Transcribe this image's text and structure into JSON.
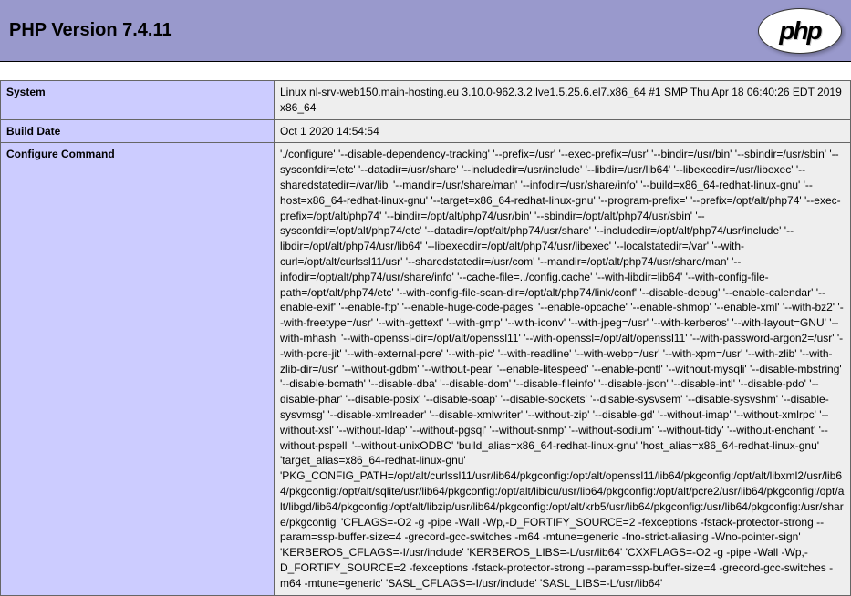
{
  "header": {
    "title": "PHP Version 7.4.11",
    "logo_text": "php"
  },
  "rows": [
    {
      "label": "System",
      "value": "Linux nl-srv-web150.main-hosting.eu 3.10.0-962.3.2.lve1.5.25.6.el7.x86_64 #1 SMP Thu Apr 18 06:40:26 EDT 2019 x86_64"
    },
    {
      "label": "Build Date",
      "value": "Oct 1 2020 14:54:54"
    },
    {
      "label": "Configure Command",
      "value": "'./configure' '--disable-dependency-tracking' '--prefix=/usr' '--exec-prefix=/usr' '--bindir=/usr/bin' '--sbindir=/usr/sbin' '--sysconfdir=/etc' '--datadir=/usr/share' '--includedir=/usr/include' '--libdir=/usr/lib64' '--libexecdir=/usr/libexec' '--sharedstatedir=/var/lib' '--mandir=/usr/share/man' '--infodir=/usr/share/info' '--build=x86_64-redhat-linux-gnu' '--host=x86_64-redhat-linux-gnu' '--target=x86_64-redhat-linux-gnu' '--program-prefix=' '--prefix=/opt/alt/php74' '--exec-prefix=/opt/alt/php74' '--bindir=/opt/alt/php74/usr/bin' '--sbindir=/opt/alt/php74/usr/sbin' '--sysconfdir=/opt/alt/php74/etc' '--datadir=/opt/alt/php74/usr/share' '--includedir=/opt/alt/php74/usr/include' '--libdir=/opt/alt/php74/usr/lib64' '--libexecdir=/opt/alt/php74/usr/libexec' '--localstatedir=/var' '--with-curl=/opt/alt/curlssl11/usr' '--sharedstatedir=/usr/com' '--mandir=/opt/alt/php74/usr/share/man' '--infodir=/opt/alt/php74/usr/share/info' '--cache-file=../config.cache' '--with-libdir=lib64' '--with-config-file-path=/opt/alt/php74/etc' '--with-config-file-scan-dir=/opt/alt/php74/link/conf' '--disable-debug' '--enable-calendar' '--enable-exif' '--enable-ftp' '--enable-huge-code-pages' '--enable-opcache' '--enable-shmop' '--enable-xml' '--with-bz2' '--with-freetype=/usr' '--with-gettext' '--with-gmp' '--with-iconv' '--with-jpeg=/usr' '--with-kerberos' '--with-layout=GNU' '--with-mhash' '--with-openssl-dir=/opt/alt/openssl11' '--with-openssl=/opt/alt/openssl11' '--with-password-argon2=/usr' '--with-pcre-jit' '--with-external-pcre' '--with-pic' '--with-readline' '--with-webp=/usr' '--with-xpm=/usr' '--with-zlib' '--with-zlib-dir=/usr' '--without-gdbm' '--without-pear' '--enable-litespeed' '--enable-pcntl' '--without-mysqli' '--disable-mbstring' '--disable-bcmath' '--disable-dba' '--disable-dom' '--disable-fileinfo' '--disable-json' '--disable-intl' '--disable-pdo' '--disable-phar' '--disable-posix' '--disable-soap' '--disable-sockets' '--disable-sysvsem' '--disable-sysvshm' '--disable-sysvmsg' '--disable-xmlreader' '--disable-xmlwriter' '--without-zip' '--disable-gd' '--without-imap' '--without-xmlrpc' '--without-xsl' '--without-ldap' '--without-pgsql' '--without-snmp' '--without-sodium' '--without-tidy' '--without-enchant' '--without-pspell' '--without-unixODBC' 'build_alias=x86_64-redhat-linux-gnu' 'host_alias=x86_64-redhat-linux-gnu' 'target_alias=x86_64-redhat-linux-gnu' 'PKG_CONFIG_PATH=/opt/alt/curlssl11/usr/lib64/pkgconfig:/opt/alt/openssl11/lib64/pkgconfig:/opt/alt/libxml2/usr/lib64/pkgconfig:/opt/alt/sqlite/usr/lib64/pkgconfig:/opt/alt/libicu/usr/lib64/pkgconfig:/opt/alt/pcre2/usr/lib64/pkgconfig:/opt/alt/libgd/lib64/pkgconfig:/opt/alt/libzip/usr/lib64/pkgconfig:/opt/alt/krb5/usr/lib64/pkgconfig:/usr/lib64/pkgconfig:/usr/share/pkgconfig' 'CFLAGS=-O2 -g -pipe -Wall -Wp,-D_FORTIFY_SOURCE=2 -fexceptions -fstack-protector-strong --param=ssp-buffer-size=4 -grecord-gcc-switches -m64 -mtune=generic -fno-strict-aliasing -Wno-pointer-sign' 'KERBEROS_CFLAGS=-I/usr/include' 'KERBEROS_LIBS=-L/usr/lib64' 'CXXFLAGS=-O2 -g -pipe -Wall -Wp,-D_FORTIFY_SOURCE=2 -fexceptions -fstack-protector-strong --param=ssp-buffer-size=4 -grecord-gcc-switches -m64 -mtune=generic' 'SASL_CFLAGS=-I/usr/include' 'SASL_LIBS=-L/usr/lib64'"
    }
  ]
}
